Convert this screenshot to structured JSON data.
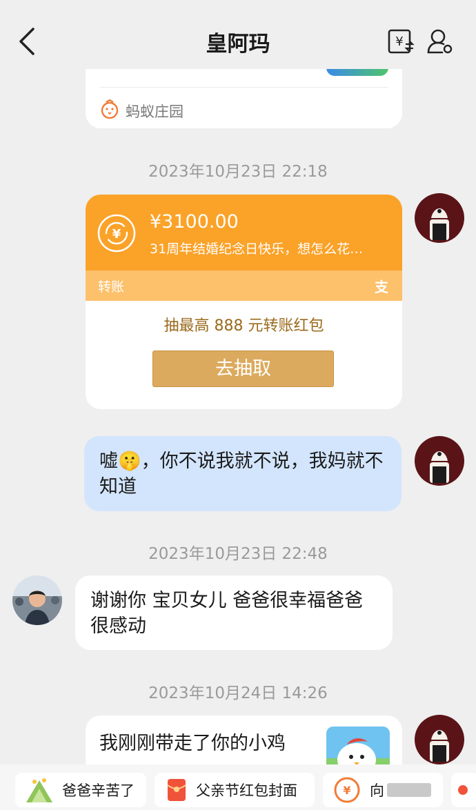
{
  "header": {
    "title": "皇阿玛"
  },
  "top_card": {
    "source_label": "蚂蚁庄园"
  },
  "timestamps": [
    "2023年10月23日 22:18",
    "2023年10月23日 22:48",
    "2023年10月24日 14:26"
  ],
  "transfer": {
    "amount": "¥3100.00",
    "note": "31周年结婚纪念日快乐，想怎么花…",
    "type_label": "转账",
    "brand_glyph": "支",
    "promo": "抽最高 888 元转账红包",
    "button_label": "去抽取"
  },
  "messages": {
    "me_1": "嘘🤫，你不说我就不说，我妈就不知道",
    "dad_1": "谢谢你 宝贝女儿    爸爸很幸福爸爸很感动",
    "me_2": "我刚刚带走了你的小鸡"
  },
  "bottom_bar": {
    "chips": [
      "爸爸辛苦了",
      "父亲节红包封面",
      "向"
    ]
  },
  "colors": {
    "transfer_orange": "#fba228",
    "transfer_band": "#fdc06b",
    "button_gold": "#dcaa5e",
    "my_bubble": "#d3e5fc",
    "promo_text": "#9a6a1c"
  }
}
